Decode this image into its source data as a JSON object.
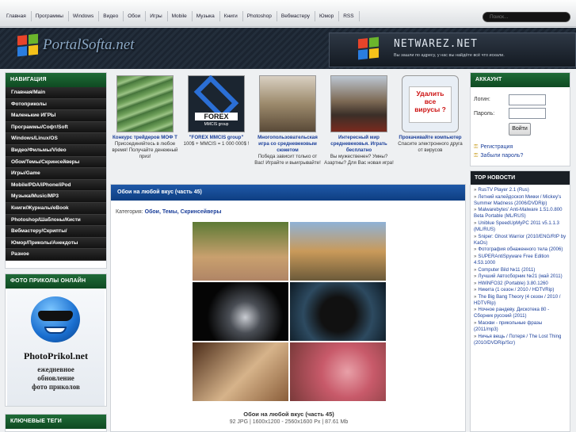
{
  "top_nav": {
    "links": [
      "Главная",
      "Программы",
      "Windows",
      "Видео",
      "Обои",
      "Игры",
      "Mobile",
      "Музыка",
      "Книги",
      "Photoshop",
      "Вебмастеру",
      "Юмор",
      "RSS"
    ],
    "search_placeholder": "Поиск..."
  },
  "header": {
    "logo_text": "PortalSofta.net",
    "banner_title": "NETWAREZ.NET",
    "banner_subtitle": "Вы зашли по адресу, у нас вы найдёте всё что искали."
  },
  "sidebar": {
    "title": "НАВИГАЦИЯ",
    "items": [
      "Главная/Main",
      "Фотоприколы",
      "Маленькие ИГРЫ",
      "Программы/Софт/Soft",
      "Windows/Linux/OS",
      "Видео/Фильмы/Video",
      "Обои/Темы/Скринсейверы",
      "Игры/Game",
      "Mobile/PDA/iPhone/iPod",
      "Музыка/Music/MP3",
      "Книги/Журналы/eBook",
      "Photoshop/Шаблоны/Кисти",
      "Вебмастеру/Скрипты/",
      "Юмор/Приколы/Анекдоты",
      "Разное"
    ]
  },
  "photo_box": {
    "title": "ФОТО ПРИКОЛЫ ОНЛАЙН",
    "logo_text": "PhotoPrikol.net",
    "logo_sub": "ежедневное\nобновление\nфото приколов"
  },
  "tags_box": {
    "title": "КЛЮЧЕВЫЕ ТЕГИ"
  },
  "promos": [
    {
      "link": "Конкурс трейдеров МОФ Т",
      "desc": "Присоединяйтесь в любое время! Получайте денежный приз!"
    },
    {
      "link": "\"FOREX MMCIS group\"",
      "desc": "100$ + MMCIS = 1 000 000$ !",
      "image_text": "FOREX",
      "image_sub": "MMCIS group"
    },
    {
      "link": "Многопользовательская игра со средневековым сюжетом",
      "desc": "Победа зависит только от Вас! Играйте и выигрывайте!"
    },
    {
      "link": "Интересный мир средневековья. Играть бесплатно",
      "desc": "Вы мужественен? Умны? Азартны? Для Вас новая игра!"
    },
    {
      "link": "Прокачивайте компьютер",
      "desc": "Спасите электронного друга от вирусов",
      "image_text": "Удалить\nвсе\nвирусы ?"
    }
  ],
  "content": {
    "heading": "Обои на любой вкус (часть 45)",
    "category_label": "Категория:",
    "category_value": "Обои, Темы, Скринсейверы",
    "image_title": "Обои на любой вкус (часть 45)",
    "image_meta": "92 JPG | 1600x1200 - 2560x1600 Px | 87.61 Mb"
  },
  "account": {
    "title": "АККАУНТ",
    "login_label": "Логин:",
    "password_label": "Пароль:",
    "login_button": "Войти",
    "register_link": "Регистрация",
    "forgot_link": "Забыли пароль?"
  },
  "news": {
    "title": "TOP НОВОСТИ",
    "items": [
      "RusTV Player 2.1 (Rus)",
      "Летний калейдоскоп Микки / Mickey's Summer Madness (2006/DVDRip)",
      "Malwarebytes' Anti-Malware 1.51.0.800 Beta Portable (ML/RUS)",
      "Uniblue SpeedUpMyPC 2011 v5.1.1.3 (ML/RUS)",
      "Sniper: Ghost Warrior (2010/ENG/RIP by KaOs)",
      "Фотография обнаженного тела (2006)",
      "SUPERAntiSpyware Free Edition 4.53.1000",
      "Computer Bild №11 (2011)",
      "Лучший Автосборник №21 (май 2011)",
      "HWiNFO32 (Portable) 3.80.1260",
      "Никита (1 сезон / 2010 / HDTVRip)",
      "The Big Bang Theory (4 сезон / 2010 / HDTVRip)",
      "Ночное рандеву. Дискотека 80 - Сборник русский (2011)",
      "Маскви - прикольные фразы (2011/mp3)",
      "Ничья вещь / Потеря / The Lost Thing (2010/DVDRip/Scr)"
    ]
  },
  "colors": {
    "green_header": "#1f6b37",
    "blue_header": "#1f59a8",
    "link": "#1b3f9a"
  }
}
